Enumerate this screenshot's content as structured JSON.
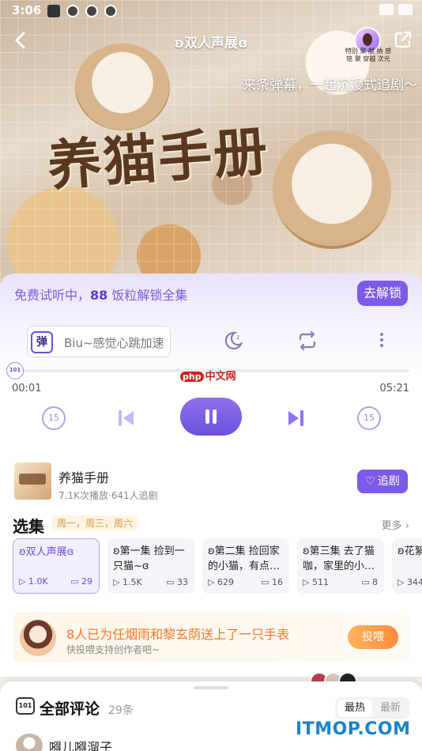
{
  "status_bar": {
    "time": "3:06"
  },
  "header": {
    "episode_title": "ʚ双人声展ɞ",
    "avatar_caption": "特别 聚 献 纳 感铭 聚 穿越 次元",
    "danmaku_tip": "来条弹幕，一起沉浸式追剧～"
  },
  "cover": {
    "title_art": "养猫手册"
  },
  "player": {
    "trial_prefix": "免费试听中，",
    "trial_amount": "88",
    "trial_suffix": " 饭粒解锁全集",
    "unlock_label": "去解锁",
    "danmu_badge": "弹",
    "danmu_placeholder": "Biu~感觉心跳加速",
    "progress_badge": "101",
    "current_time": "00:01",
    "total_time": "05:21",
    "skip_back_label": "15",
    "skip_forward_label": "15",
    "watermark": "中文网",
    "watermark_prefix": "php"
  },
  "drama": {
    "name": "养猫手册",
    "stats": "7.1K次播放·641人追剧",
    "follow_label": "追剧"
  },
  "episodes": {
    "section_title": "选集",
    "schedule": "周一，周三，周六",
    "more_label": "更多",
    "items": [
      {
        "label": "ʚ双人声展ɞ",
        "plays": "1.0K",
        "comments": "29"
      },
      {
        "label": "ʚ第一集 捡到一只猫~ɞ",
        "plays": "1.5K",
        "comments": "33"
      },
      {
        "label": "ʚ第二集 捡回家的小猫，有点…",
        "plays": "629",
        "comments": "16"
      },
      {
        "label": "ʚ第三集 去了猫咖，家里的小…",
        "plays": "511",
        "comments": "8"
      },
      {
        "label": "ʚ花絮 使用…",
        "plays": "344",
        "comments": ""
      }
    ]
  },
  "gift": {
    "text": "8人已为任烟雨和黎玄荫送上了一只手表",
    "sub": "快投喂支持创作者吧~",
    "feed_label": "投喂"
  },
  "comments": {
    "title": "全部评论",
    "count": "29条",
    "sort_hot": "最热",
    "sort_new": "最新",
    "first_user": "嘚儿嘚溜子",
    "icon_text": "101"
  },
  "site_watermark": "ITMOP.COM",
  "colors": {
    "accent": "#7b5be8",
    "accent_light": "#b3a1ef",
    "gift_orange": "#f07a2e"
  }
}
